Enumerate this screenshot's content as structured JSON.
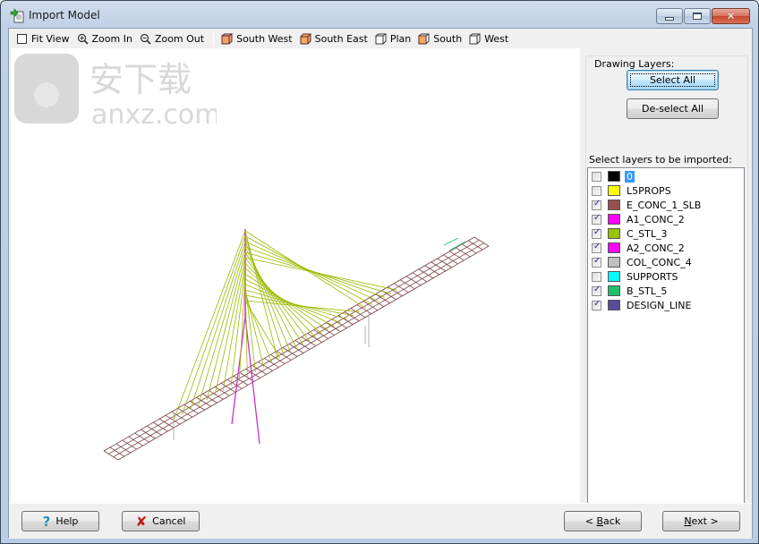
{
  "window": {
    "title": "Import Model",
    "controls": {
      "minimize": "minimize",
      "maximize": "maximize",
      "close": "close"
    }
  },
  "toolbar": {
    "items": [
      {
        "id": "fit-view",
        "label": "Fit View",
        "icon": "square-icon"
      },
      {
        "id": "zoom-in",
        "label": "Zoom In",
        "icon": "zoom-in-icon"
      },
      {
        "id": "zoom-out",
        "label": "Zoom Out",
        "icon": "zoom-out-icon"
      },
      {
        "id": "south-west",
        "label": "South West",
        "icon": "cube-sw-icon"
      },
      {
        "id": "south-east",
        "label": "South East",
        "icon": "cube-se-icon"
      },
      {
        "id": "plan",
        "label": "Plan",
        "icon": "cube-plan-icon"
      },
      {
        "id": "south",
        "label": "South",
        "icon": "cube-south-icon"
      },
      {
        "id": "west",
        "label": "West",
        "icon": "cube-west-icon"
      }
    ]
  },
  "side_panel": {
    "group_title": "Drawing Layers:",
    "select_all": "Select All",
    "deselect_all": "De-select All",
    "layers_label": "Select layers to be imported:",
    "layers": [
      {
        "name": "0",
        "checked": false,
        "color": "#000000",
        "selected": true
      },
      {
        "name": "L5PROPS",
        "checked": false,
        "color": "#ffff00",
        "selected": false
      },
      {
        "name": "E_CONC_1_SLB",
        "checked": true,
        "color": "#9a4f4f",
        "selected": false
      },
      {
        "name": "A1_CONC_2",
        "checked": true,
        "color": "#ff00ff",
        "selected": false
      },
      {
        "name": "C_STL_3",
        "checked": true,
        "color": "#99c400",
        "selected": false
      },
      {
        "name": "A2_CONC_2",
        "checked": true,
        "color": "#ff00ff",
        "selected": false
      },
      {
        "name": "COL_CONC_4",
        "checked": true,
        "color": "#c0c0c0",
        "selected": false
      },
      {
        "name": "SUPPORTS",
        "checked": false,
        "color": "#00ffff",
        "selected": false
      },
      {
        "name": "B_STL_5",
        "checked": true,
        "color": "#1ec06a",
        "selected": false
      },
      {
        "name": "DESIGN_LINE",
        "checked": true,
        "color": "#5a4a9c",
        "selected": false
      }
    ]
  },
  "footer": {
    "help": "Help",
    "cancel": "Cancel",
    "back_prefix": "< ",
    "back_mnemonic": "B",
    "back_rest": "ack",
    "next_mnemonic": "N",
    "next_rest": "ext >"
  },
  "viewport": {
    "description": "3D wireframe preview of cable-stayed bridge",
    "colors": {
      "deck": "#7a4040",
      "cables": "#9cb800",
      "pylon": "#cc22cc",
      "column": "#b0b0b0",
      "bearing": "#1ec06a"
    }
  },
  "watermark": {
    "text_cn": "安下载",
    "text_en": "anxz.com"
  }
}
